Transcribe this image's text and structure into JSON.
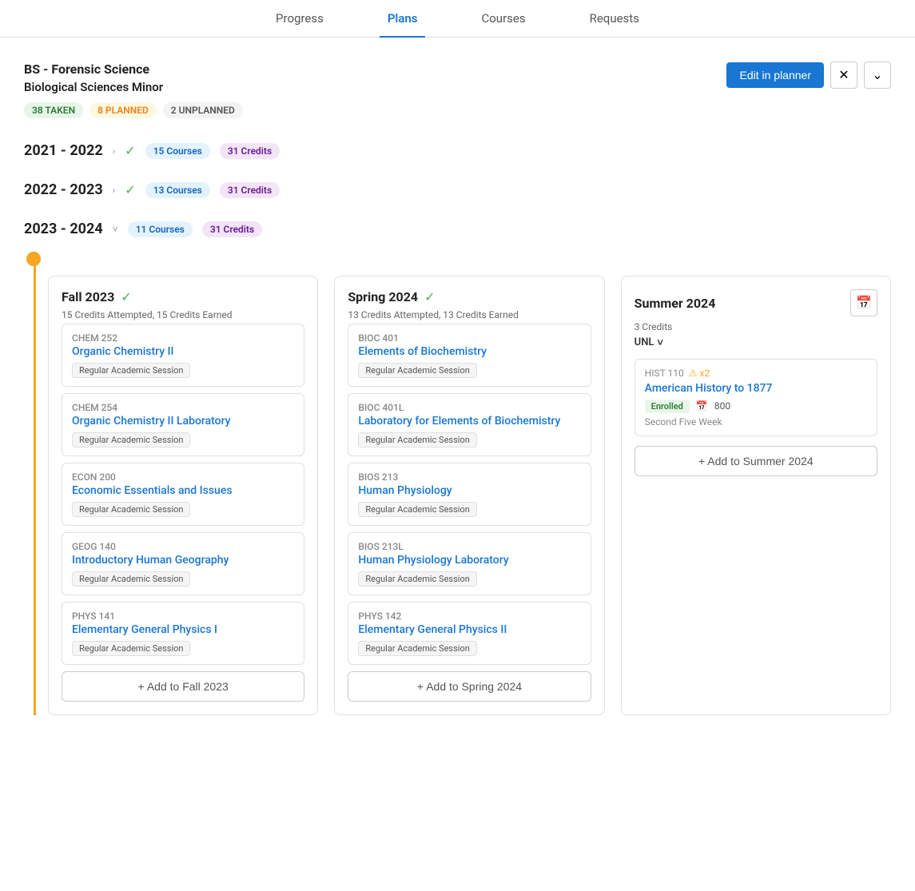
{
  "nav": {
    "items": [
      {
        "label": "Progress",
        "active": false
      },
      {
        "label": "Plans",
        "active": true
      },
      {
        "label": "Courses",
        "active": false
      },
      {
        "label": "Requests",
        "active": false
      }
    ]
  },
  "plan": {
    "degree": "BS - Forensic Science",
    "minor": "Biological Sciences Minor",
    "taken": "38 TAKEN",
    "planned": "8 PLANNED",
    "unplanned": "2 UNPLANNED",
    "edit_button": "Edit in planner"
  },
  "years": [
    {
      "label": "2021 - 2022",
      "expanded": false,
      "check": true,
      "courses": "15 Courses",
      "credits": "31 Credits"
    },
    {
      "label": "2022 - 2023",
      "expanded": false,
      "check": true,
      "courses": "13 Courses",
      "credits": "31 Credits"
    },
    {
      "label": "2023 - 2024",
      "expanded": true,
      "check": false,
      "courses": "11 Courses",
      "credits": "31 Credits"
    }
  ],
  "semesters": [
    {
      "id": "fall2023",
      "title": "Fall 2023",
      "completed": true,
      "credits_info": "15 Credits Attempted, 15 Credits Earned",
      "add_label": "+ Add to Fall 2023",
      "courses": [
        {
          "code": "CHEM 252",
          "name": "Organic Chemistry II",
          "session": "Regular Academic Session"
        },
        {
          "code": "CHEM 254",
          "name": "Organic Chemistry II Laboratory",
          "session": "Regular Academic Session"
        },
        {
          "code": "ECON 200",
          "name": "Economic Essentials and Issues",
          "session": "Regular Academic Session"
        },
        {
          "code": "GEOG 140",
          "name": "Introductory Human Geography",
          "session": "Regular Academic Session"
        },
        {
          "code": "PHYS 141",
          "name": "Elementary General Physics I",
          "session": "Regular Academic Session"
        }
      ]
    },
    {
      "id": "spring2024",
      "title": "Spring 2024",
      "completed": true,
      "credits_info": "13 Credits Attempted, 13 Credits Earned",
      "add_label": "+ Add to Spring 2024",
      "courses": [
        {
          "code": "BIOC 401",
          "name": "Elements of Biochemistry",
          "session": "Regular Academic Session"
        },
        {
          "code": "BIOC 401L",
          "name": "Laboratory for Elements of Biochemistry",
          "session": "Regular Academic Session"
        },
        {
          "code": "BIOS 213",
          "name": "Human Physiology",
          "session": "Regular Academic Session"
        },
        {
          "code": "BIOS 213L",
          "name": "Human Physiology Laboratory",
          "session": "Regular Academic Session"
        },
        {
          "code": "PHYS 142",
          "name": "Elementary General Physics II",
          "session": "Regular Academic Session"
        }
      ]
    },
    {
      "id": "summer2024",
      "title": "Summer 2024",
      "completed": false,
      "credits_info": "3 Credits",
      "unl_label": "UNL",
      "add_label": "+ Add to Summer 2024",
      "enrolled_course": {
        "code": "HIST 110",
        "warning": "⚠ x2",
        "name": "American History to 1877",
        "status": "Enrolled",
        "capacity": "800",
        "session": "Second Five Week"
      }
    }
  ]
}
